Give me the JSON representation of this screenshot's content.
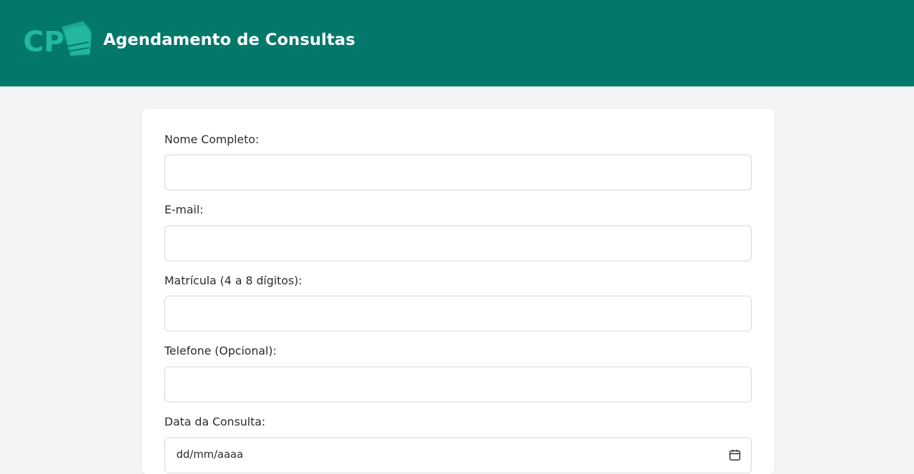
{
  "header": {
    "title": "Agendamento de Consultas",
    "logo_text": "CP",
    "colors": {
      "background": "#02786b",
      "logo": "#22b89f",
      "text": "#ffffff"
    }
  },
  "form": {
    "fields": [
      {
        "label": "Nome Completo:",
        "value": "",
        "placeholder": ""
      },
      {
        "label": "E-mail:",
        "value": "",
        "placeholder": ""
      },
      {
        "label": "Matrícula (4 a 8 dígitos):",
        "value": "",
        "placeholder": ""
      },
      {
        "label": "Telefone (Opcional):",
        "value": "",
        "placeholder": ""
      },
      {
        "label": "Data da Consulta:",
        "value": "dd/mm/aaaa",
        "placeholder": "",
        "icon": "calendar-icon"
      }
    ]
  }
}
